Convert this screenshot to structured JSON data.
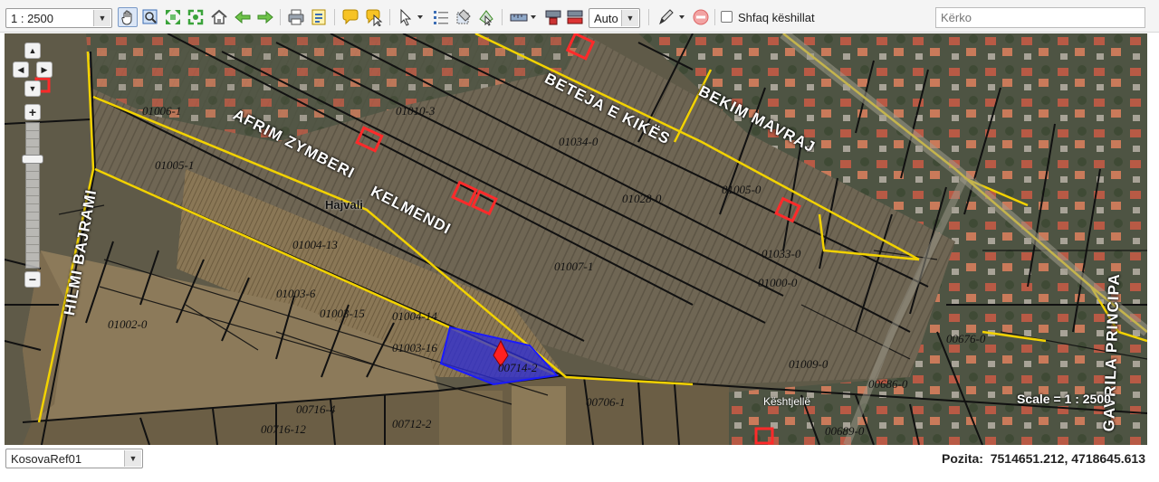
{
  "toolbar": {
    "scale_select": "1 : 2500",
    "tools": [
      {
        "name": "pan-icon"
      },
      {
        "name": "zoom-box-icon"
      },
      {
        "name": "zoom-extent-icon"
      },
      {
        "name": "zoom-full-icon"
      },
      {
        "name": "home-icon"
      },
      {
        "name": "back-arrow-icon"
      },
      {
        "name": "forward-arrow-icon"
      },
      {
        "name": "print-icon"
      },
      {
        "name": "export-icon"
      },
      {
        "name": "comment-icon"
      },
      {
        "name": "identify-icon"
      },
      {
        "name": "select-pointer-icon"
      },
      {
        "name": "layer-list-icon"
      },
      {
        "name": "clear-selection-icon"
      },
      {
        "name": "select-shape-icon"
      },
      {
        "name": "measure-icon"
      },
      {
        "name": "overview-icon"
      },
      {
        "name": "basemap-icon"
      },
      {
        "name": "draw-pencil-icon"
      },
      {
        "name": "remove-icon"
      }
    ],
    "auto_select": "Auto",
    "show_hints_label": "Shfaq këshillat",
    "show_hints_checked": false,
    "search_placeholder": "Kërko"
  },
  "map": {
    "street_labels": [
      "AFRIM ZYMBERI",
      "BETEJA E KIKËS",
      "BEKIM MAVRAJ",
      "KELMENDI",
      "HILMI BAJRAMI",
      "GAVRILA PRINCIPA"
    ],
    "place_labels": [
      "Hajvali",
      "Kështjellë"
    ],
    "parcel_labels": [
      "01010-3",
      "01034-0",
      "01028-0",
      "01007-1",
      "01002-0",
      "01003-16",
      "00714-2",
      "01006-1",
      "01005-1",
      "01004-13",
      "01003-6",
      "01003-15",
      "01004-14",
      "00716-4",
      "00716-12",
      "00712-2",
      "00706-1",
      "01009-0",
      "01033-0",
      "01005-0",
      "01000-0",
      "00676-0",
      "00686-0",
      "00689-0"
    ],
    "scale_text": "Scale = 1 : 2500",
    "selected_parcel_color": "#2b2bd8",
    "building_color": "#ff2a2a",
    "road_color": "#f2d200",
    "parcel_line_color": "#111111"
  },
  "statusbar": {
    "reference_select": "KosovaRef01",
    "position_label": "Pozita:",
    "position_value": "7514651.212, 4718645.613"
  }
}
